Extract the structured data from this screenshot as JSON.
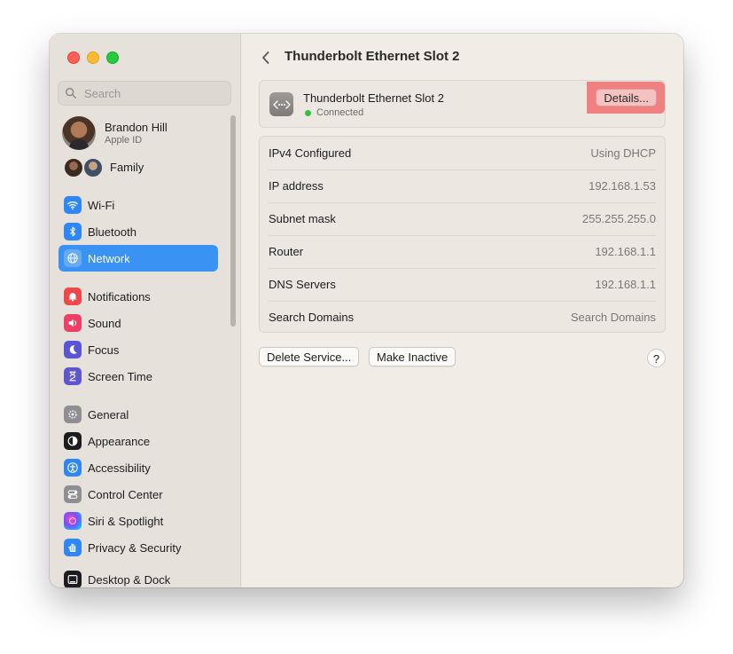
{
  "window": {
    "traffic_lights": [
      "close",
      "minimize",
      "zoom"
    ],
    "title": "Thunderbolt Ethernet Slot 2"
  },
  "sidebar": {
    "search": {
      "placeholder": "Search",
      "value": ""
    },
    "profile": {
      "name": "Brandon Hill",
      "subtitle": "Apple ID"
    },
    "family": {
      "label": "Family"
    },
    "groups": [
      [
        {
          "label": "Wi-Fi",
          "icon": "wifi-icon",
          "color": "#2f86f6"
        },
        {
          "label": "Bluetooth",
          "icon": "bluetooth-icon",
          "color": "#2f86f6"
        },
        {
          "label": "Network",
          "icon": "globe-icon",
          "color": "#2f86f6",
          "active": true
        }
      ],
      [
        {
          "label": "Notifications",
          "icon": "bell-icon",
          "color": "#f0474b"
        },
        {
          "label": "Sound",
          "icon": "speaker-icon",
          "color": "#ee3e66"
        },
        {
          "label": "Focus",
          "icon": "moon-icon",
          "color": "#5b55d6"
        },
        {
          "label": "Screen Time",
          "icon": "hourglass-icon",
          "color": "#5e56cf"
        }
      ],
      [
        {
          "label": "General",
          "icon": "gear-icon",
          "color": "#8e8e93"
        },
        {
          "label": "Appearance",
          "icon": "appearance-icon",
          "color": "#1c1c1e"
        },
        {
          "label": "Accessibility",
          "icon": "accessibility-icon",
          "color": "#2f86f6"
        },
        {
          "label": "Control Center",
          "icon": "toggles-icon",
          "color": "#8e8e93"
        },
        {
          "label": "Siri & Spotlight",
          "icon": "siri-icon",
          "color": "#7b4cff"
        },
        {
          "label": "Privacy & Security",
          "icon": "hand-icon",
          "color": "#2f86f6"
        },
        {
          "label": "Desktop & Dock",
          "icon": "dock-icon",
          "color": "#1c1c1e"
        }
      ]
    ]
  },
  "main": {
    "header_title": "Thunderbolt Ethernet Slot 2",
    "service": {
      "name": "Thunderbolt Ethernet Slot 2",
      "status": "Connected",
      "status_color": "#30c24a",
      "details_label": "Details..."
    },
    "info_rows": [
      {
        "label": "IPv4 Configured",
        "value": "Using DHCP"
      },
      {
        "label": "IP address",
        "value": "192.168.1.53"
      },
      {
        "label": "Subnet mask",
        "value": "255.255.255.0"
      },
      {
        "label": "Router",
        "value": "192.168.1.1"
      },
      {
        "label": "DNS Servers",
        "value": "192.168.1.1"
      },
      {
        "label": "Search Domains",
        "value": "Search Domains"
      }
    ],
    "buttons": {
      "delete_service": "Delete Service...",
      "make_inactive": "Make Inactive",
      "help": "?"
    }
  }
}
